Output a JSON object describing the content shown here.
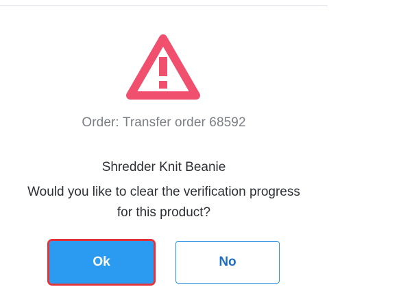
{
  "dialog": {
    "icon": "warning-triangle-icon",
    "order_label": "Order: Transfer order 68592",
    "product_name": "Shredder Knit Beanie",
    "question": "Would you like to clear the verification progress for this product?",
    "buttons": {
      "ok_label": "Ok",
      "no_label": "No"
    }
  },
  "colors": {
    "warning": "#f0506e",
    "primary": "#2a9bf0",
    "focus_outline": "#e2333a"
  }
}
